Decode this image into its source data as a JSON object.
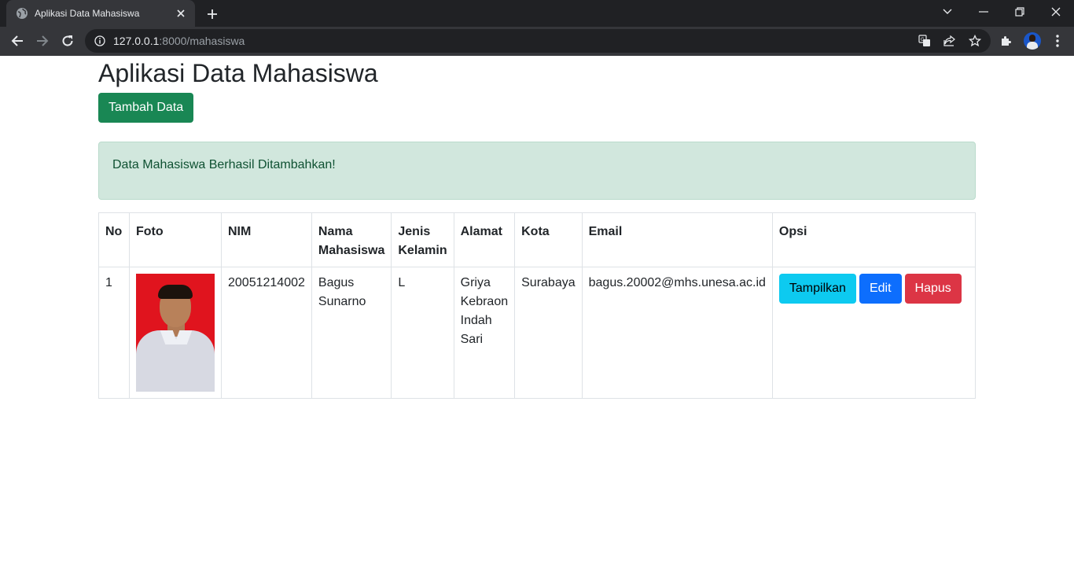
{
  "browser": {
    "tab_title": "Aplikasi Data Mahasiswa",
    "url_host": "127.0.0.1",
    "url_rest": ":8000/mahasiswa",
    "icons": [
      "globe-icon",
      "close-icon",
      "plus-icon",
      "back-icon",
      "forward-icon",
      "reload-icon",
      "info-icon",
      "translate-icon",
      "share-icon",
      "star-icon",
      "extensions-icon",
      "menu-icon"
    ]
  },
  "page": {
    "title": "Aplikasi Data Mahasiswa",
    "add_button": "Tambah Data",
    "alert": "Data Mahasiswa Berhasil Ditambahkan!"
  },
  "table": {
    "headers": [
      "No",
      "Foto",
      "NIM",
      "Nama Mahasiswa",
      "Jenis Kelamin",
      "Alamat",
      "Kota",
      "Email",
      "Opsi"
    ],
    "rows": [
      {
        "no": "1",
        "nim": "20051214002",
        "nama": "Bagus Sunarno",
        "jenis_kelamin": "L",
        "alamat": "Griya Kebraon Indah Sari",
        "kota": "Surabaya",
        "email": "bagus.20002@mhs.unesa.ac.id",
        "actions": {
          "show": "Tampilkan",
          "edit": "Edit",
          "delete": "Hapus"
        }
      }
    ]
  },
  "colors": {
    "success": "#198754",
    "alert_bg": "#d1e7dd",
    "info": "#0dcaf0",
    "primary": "#0d6efd",
    "danger": "#dc3545"
  }
}
